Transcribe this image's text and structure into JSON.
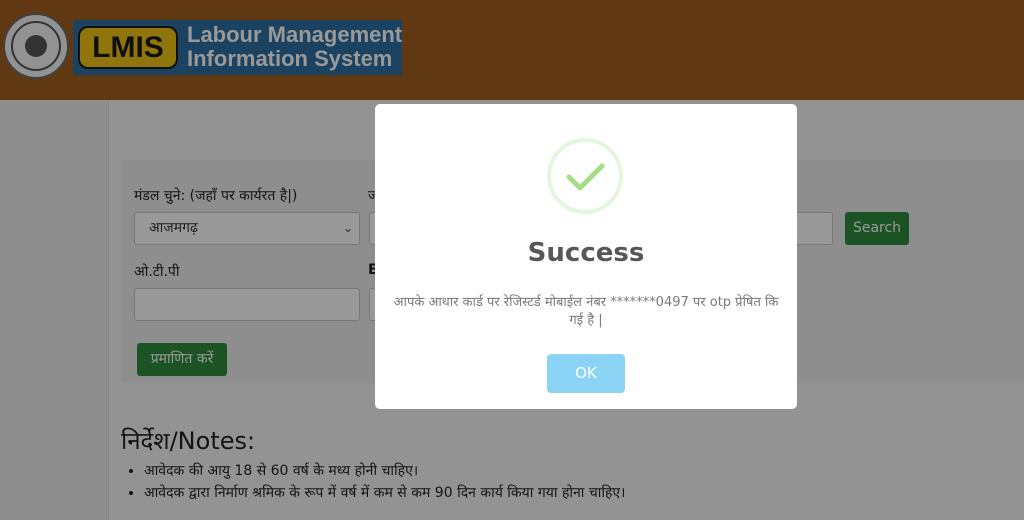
{
  "header": {
    "emblem_icon": "up-govt-emblem",
    "logo_short": "LMIS",
    "logo_line1": "Labour Management",
    "logo_line2": "Information System"
  },
  "form": {
    "division_label": "मंडल चुने: (जहाँ पर कार्यरत है|)",
    "division_value": "आजमगढ़",
    "second_label_partial": "ज",
    "search_button": "Search",
    "otp_label": "ओ.टी.पी",
    "otp_value": "",
    "bold_label_partial": "E",
    "verify_button": "प्रमाणित करें"
  },
  "notes": {
    "title": "निर्देश/Notes:",
    "items": [
      "आवेदक की आयु 18 से 60 वर्ष के मध्य होनी चाहिए।",
      "आवेदक द्वारा निर्माण श्रमिक के रूप में वर्ष में कम से कम 90 दिन कार्य किया गया होना चाहिए।"
    ]
  },
  "modal": {
    "icon": "success-check-icon",
    "title": "Success",
    "message": "आपके आधार कार्ड पर रेजिस्टर्ड मोबाईल नंबर *******0497 पर otp प्रेषित कि गई है |",
    "ok_button": "OK"
  },
  "colors": {
    "header_bg": "#a15f1f",
    "logo_bg": "#2d6fa0",
    "logo_badge": "#f0c415",
    "button_green": "#2e8b3e",
    "ok_blue": "#8cd4f5",
    "check_green": "#a5dc86"
  }
}
